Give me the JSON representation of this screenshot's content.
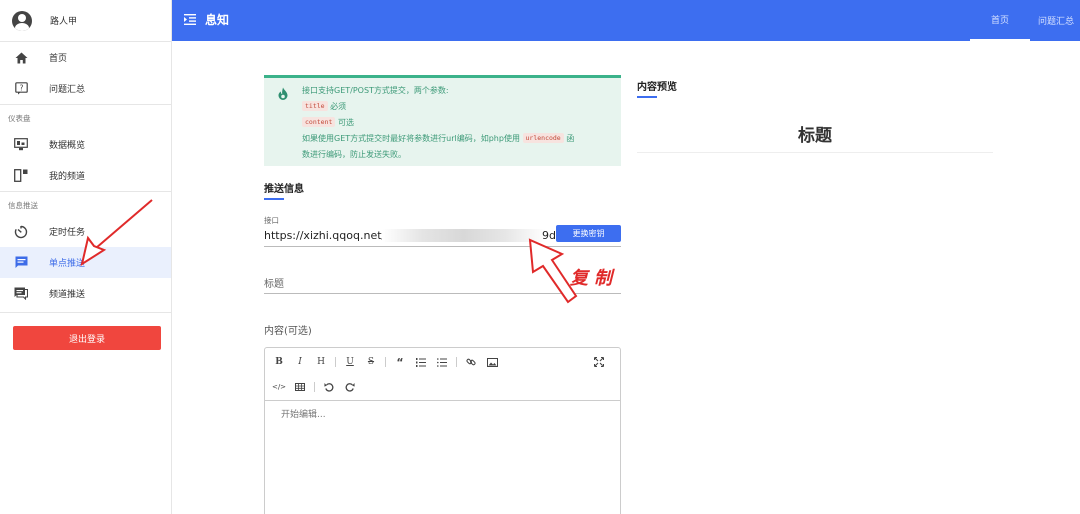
{
  "user": {
    "name": "路人甲"
  },
  "sidebar": {
    "top_items": [
      {
        "label": "首页",
        "icon": "home-icon"
      },
      {
        "label": "问题汇总",
        "icon": "question-icon"
      }
    ],
    "groups": [
      {
        "label": "仪表盘",
        "items": [
          {
            "label": "数据概览",
            "icon": "monitor-icon"
          },
          {
            "label": "我的频道",
            "icon": "channel-icon"
          }
        ]
      },
      {
        "label": "信息推送",
        "items": [
          {
            "label": "定时任务",
            "icon": "timer-icon"
          },
          {
            "label": "单点推送",
            "icon": "message-icon",
            "active": true
          },
          {
            "label": "频道推送",
            "icon": "broadcast-icon"
          }
        ]
      }
    ],
    "logout_label": "退出登录"
  },
  "header": {
    "brand": "息知",
    "tabs": [
      {
        "label": "首页"
      },
      {
        "label": "问题汇总"
      }
    ],
    "accent": "#3d6ef0"
  },
  "notice": {
    "line1": "接口支持GET/POST方式提交，两个参数:",
    "title_code": "title",
    "title_note": "必须",
    "content_code": "content",
    "content_note": "可选",
    "line4a": "如果使用GET方式提交时最好将参数进行url编码，如php使用",
    "urlencode_code": "urlencode",
    "line4b": "函",
    "line5": "数进行编码，防止发送失败。"
  },
  "push_info": {
    "section_title": "推送信息",
    "endpoint_label": "接口",
    "endpoint_prefix": "https://xizhi.qqoq.net/",
    "endpoint_suffix": "9dde",
    "change_key_button": "更换密钥",
    "title_placeholder": "标题",
    "content_label": "内容(可选)",
    "editor_placeholder": "开始编辑..."
  },
  "preview": {
    "section_title": "内容预览",
    "heading": "标题"
  },
  "annotation": {
    "copy_text": "复制",
    "color": "#e02a2a"
  }
}
